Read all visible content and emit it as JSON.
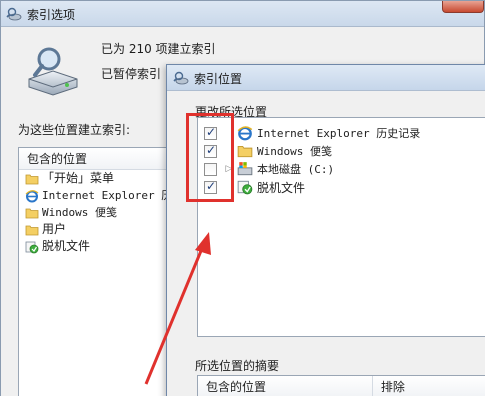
{
  "back_window": {
    "title": "索引选项",
    "stats_line1": "已为 210 项建立索引",
    "stats_line2": "已暂停索引",
    "stats_line2_suffix": "。",
    "locations_label": "为这些位置建立索引:",
    "included_header": "包含的位置",
    "included_items": [
      {
        "label": "「开始」菜单",
        "icon": "folder-icon"
      },
      {
        "label": "Internet Explorer 历",
        "icon": "ie-icon"
      },
      {
        "label": "Windows 便笺",
        "icon": "folder-icon"
      },
      {
        "label": "用户",
        "icon": "folder-icon"
      },
      {
        "label": "脱机文件",
        "icon": "offline-files-icon"
      }
    ]
  },
  "dialog": {
    "title": "索引位置",
    "change_label": "更改所选位置",
    "tree": [
      {
        "label": "Internet Explorer 历史记录",
        "checked": true,
        "expandable": false,
        "icon": "ie-icon"
      },
      {
        "label": "Windows 便笺",
        "checked": true,
        "expandable": false,
        "icon": "folder-icon"
      },
      {
        "label": "本地磁盘 (C:)",
        "checked": false,
        "expandable": true,
        "icon": "local-disk-icon"
      },
      {
        "label": "脱机文件",
        "checked": true,
        "expandable": false,
        "icon": "offline-files-icon"
      }
    ],
    "summary_label": "所选位置的摘要",
    "summary_col_included": "包含的位置",
    "summary_col_excluded": "排除"
  },
  "colors": {
    "annotation_red": "#e0312d"
  }
}
